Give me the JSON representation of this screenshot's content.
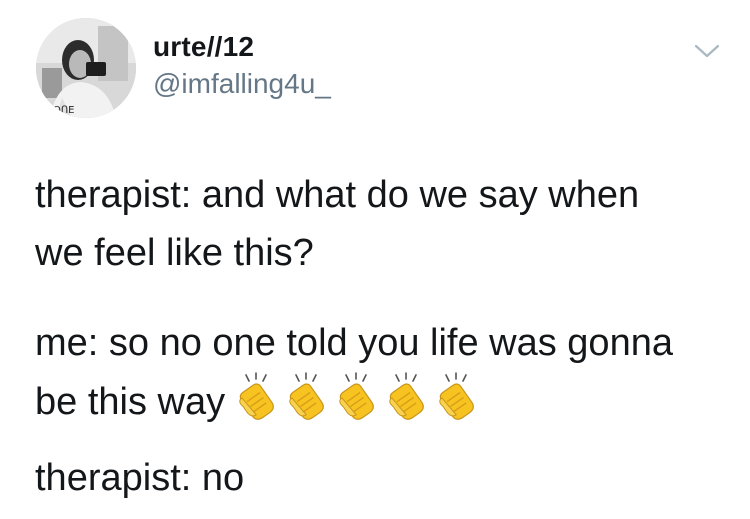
{
  "tweet": {
    "display_name": "urte//12",
    "handle": "@imfalling4u_",
    "avatar_icon": "profile-photo-avatar",
    "menu_icon": "chevron-down-icon",
    "body": {
      "p1_line1": "therapist: and what do we say when",
      "p1_line2": "we feel like this?",
      "p2_line1": "me: so no one told you life was gonna",
      "p2_line2": "be this way",
      "p3_line1": "therapist: no"
    },
    "emoji": {
      "name": "clapping-hands-icon",
      "count": 5
    }
  },
  "colors": {
    "text": "#14171a",
    "handle": "#657786",
    "chevron": "#aab8c2",
    "clap_yellow": "#f7c321"
  }
}
